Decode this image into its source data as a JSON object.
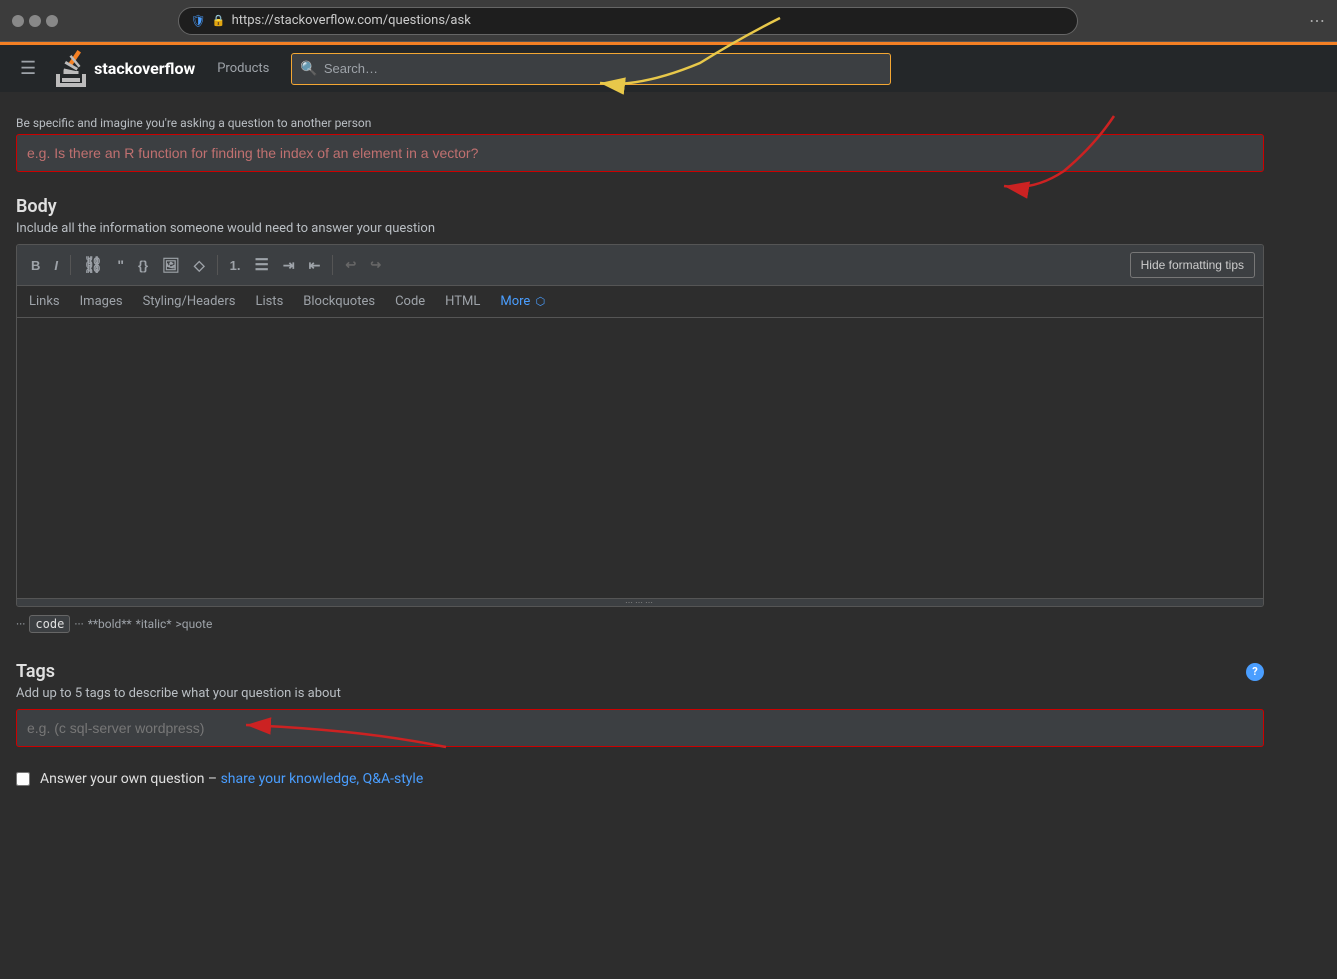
{
  "browser": {
    "url": "https://stackoverflow.com/questions/ask"
  },
  "navbar": {
    "hamburger_label": "☰",
    "logo_text_start": "stack",
    "logo_text_bold": "overflow",
    "products_label": "Products",
    "search_placeholder": "Search…"
  },
  "page": {
    "title_section": {
      "label": "Be specific and imagine you're asking a question to another person",
      "placeholder": "e.g. Is there an R function for finding the index of an element in a vector?"
    },
    "body_section": {
      "title": "Body",
      "description": "Include all the information someone would need to answer your question",
      "toolbar": {
        "buttons": [
          "B",
          "I",
          "🔗",
          "❝",
          "{}",
          "🖼",
          "◇",
          "1.",
          "•",
          "≡",
          "⊟",
          "↩",
          "↪"
        ],
        "hide_tips_label": "Hide formatting tips"
      },
      "formatting_tabs": {
        "links": "Links",
        "images": "Images",
        "styling_headers": "Styling/Headers",
        "lists": "Lists",
        "blockquotes": "Blockquotes",
        "code": "Code",
        "html": "HTML",
        "more": "More"
      }
    },
    "formatting_hint": {
      "dots1": "···",
      "code_label": "code",
      "dots2": "···",
      "bold_hint": "**bold**",
      "italic_hint": "*italic*",
      "quote_hint": ">quote"
    },
    "tags_section": {
      "title": "Tags",
      "description": "Add up to 5 tags to describe what your question is about",
      "placeholder": "e.g. (c sql-server wordpress)"
    },
    "self_answer": {
      "label_start": "Answer your own question –",
      "link_text": "share your knowledge, Q&A-style",
      "label_end": ""
    }
  }
}
